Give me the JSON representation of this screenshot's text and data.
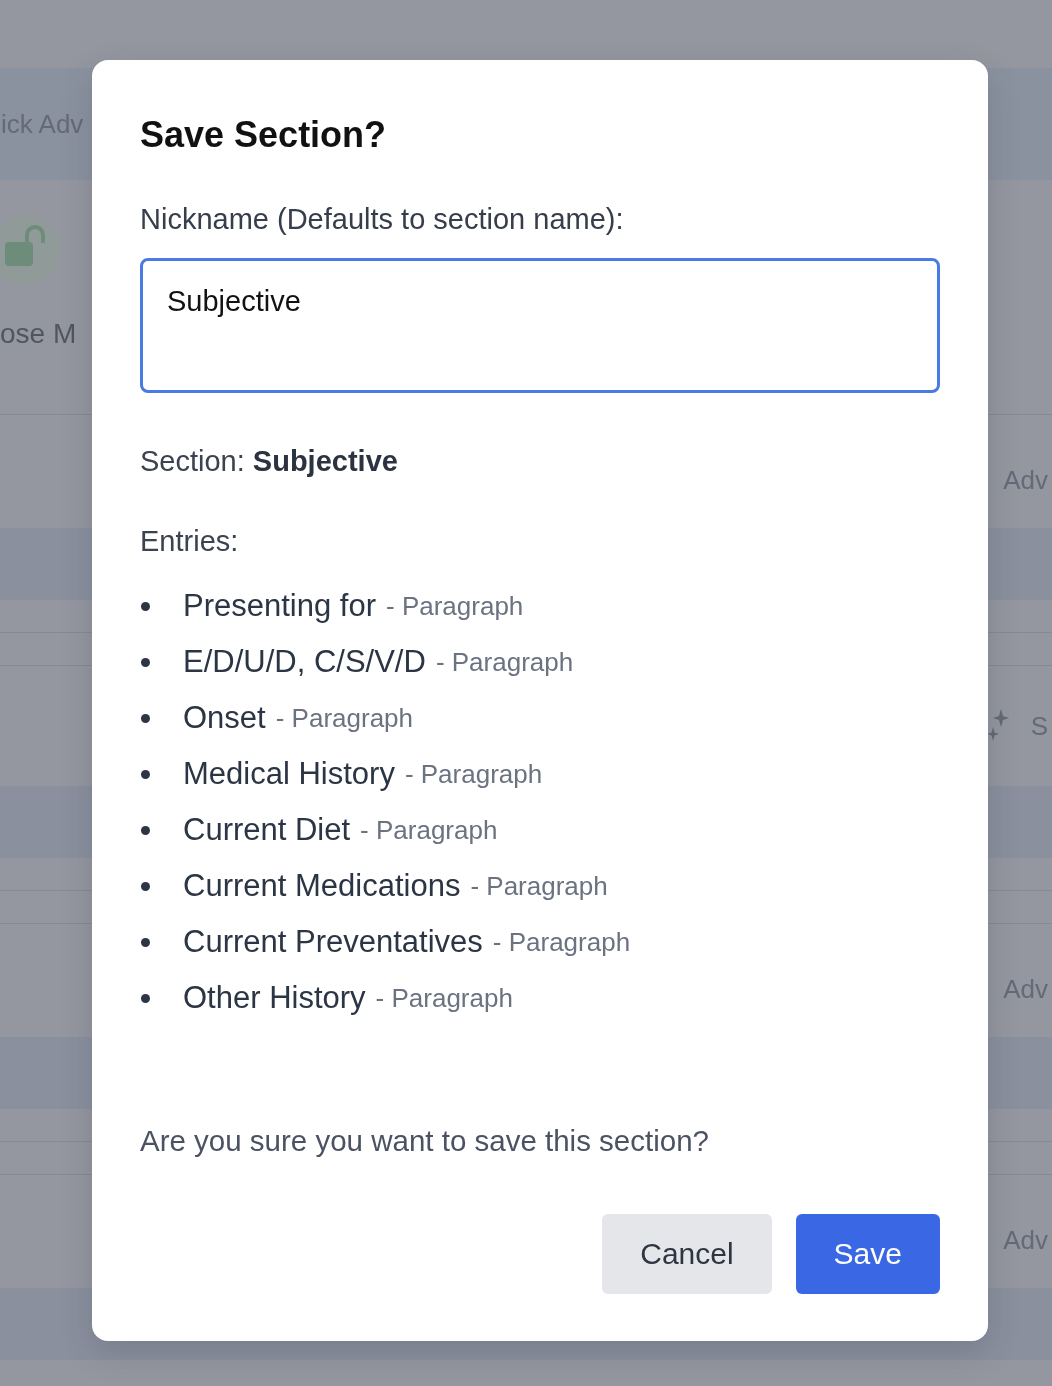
{
  "backdrop": {
    "rows": [
      {
        "kind": "toolbar",
        "left_text": "ick Adv"
      },
      {
        "kind": "lock-item",
        "left_text": "ose M"
      },
      {
        "kind": "item",
        "right_text": "Adv"
      },
      {
        "kind": "band"
      },
      {
        "kind": "thin"
      },
      {
        "kind": "thin"
      },
      {
        "kind": "sparkle-item",
        "right_text": "S"
      },
      {
        "kind": "band"
      },
      {
        "kind": "thin"
      },
      {
        "kind": "thin"
      },
      {
        "kind": "item",
        "right_text": "Adv"
      },
      {
        "kind": "band"
      },
      {
        "kind": "thin"
      },
      {
        "kind": "thin"
      },
      {
        "kind": "item",
        "right_text": "Adv"
      },
      {
        "kind": "band"
      }
    ]
  },
  "dialog": {
    "title": "Save Section?",
    "nickname_field": {
      "label": "Nickname (Defaults to section name):",
      "value": "Subjective",
      "focused": true
    },
    "section_line": "Section: **Subjective**",
    "entries_label": "Entries:",
    "entries": [
      {
        "name": "Presenting for",
        "detail": "- Paragraph"
      },
      {
        "name": "E/D/U/D, C/S/V/D",
        "detail": "- Paragraph"
      },
      {
        "name": "Onset",
        "detail": "- Paragraph"
      },
      {
        "name": "Medical History",
        "detail": "- Paragraph"
      },
      {
        "name": "Current Diet",
        "detail": "- Paragraph"
      },
      {
        "name": "Current Medications",
        "detail": "- Paragraph"
      },
      {
        "name": "Current Preventatives",
        "detail": "- Paragraph"
      },
      {
        "name": "Other History",
        "detail": "- Paragraph"
      }
    ],
    "question": "Are you sure you want to save this section?",
    "buttons": [
      {
        "label": "Cancel",
        "kind": "secondary"
      },
      {
        "label": "Save",
        "kind": "primary"
      }
    ]
  }
}
